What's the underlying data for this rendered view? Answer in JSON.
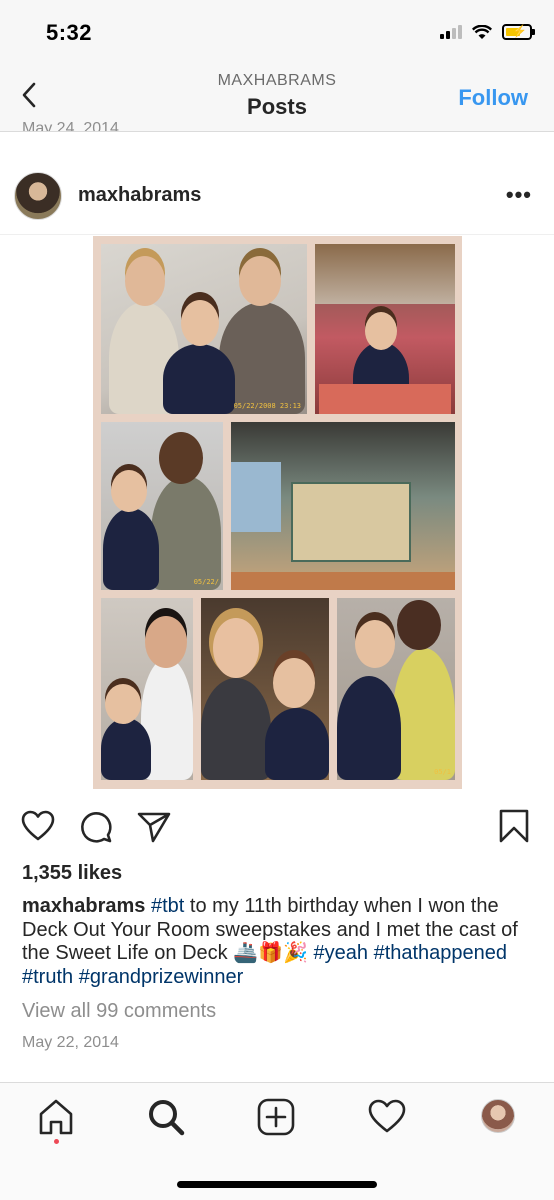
{
  "status_bar": {
    "time": "5:32"
  },
  "header": {
    "subtitle": "MAXHABRAMS",
    "title": "Posts",
    "follow_label": "Follow",
    "previous_post_date": "May 24, 2014"
  },
  "post": {
    "username": "maxhabrams",
    "likes": "1,355 likes",
    "caption": {
      "username": "maxhabrams",
      "tag_tbt": "#tbt",
      "text_1": " to my 11th birthday when I won the Deck Out Your Room sweepstakes and I met the cast of the Sweet Life on Deck ",
      "emojis": "🚢🎁🎉",
      "tag_yeah": "#yeah",
      "tag_thathappened": "#thathappened",
      "tag_truth": "#truth",
      "tag_grandprize": "#grandprizewinner"
    },
    "view_comments": "View all 99 comments",
    "date": "May 22, 2014",
    "photo_stamps": [
      "05/22/2008 23:13",
      "05/22/",
      "05/1"
    ]
  },
  "icons": {
    "back": "chevron-left-icon",
    "more": "more-horizontal-icon",
    "like": "heart-icon",
    "comment": "comment-icon",
    "share": "paper-plane-icon",
    "save": "bookmark-icon",
    "home": "home-icon",
    "search": "search-icon",
    "new_post": "plus-square-icon",
    "activity": "heart-icon"
  },
  "colors": {
    "accent": "#3897f0",
    "hashtag": "#003569",
    "notification_dot": "#ed4956"
  }
}
